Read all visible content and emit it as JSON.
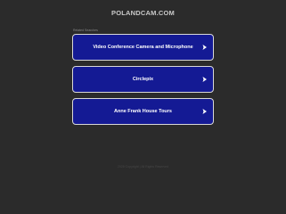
{
  "header": {
    "domain": "POLANDCAM.COM"
  },
  "related": {
    "label": "Related Searches",
    "links": [
      {
        "label": "Video Conference Camera and Microphone",
        "icon": "arrow-right-icon"
      },
      {
        "label": "Circlepix",
        "icon": "arrow-right-icon"
      },
      {
        "label": "Anne Frank House Tours",
        "icon": "arrow-right-icon"
      }
    ]
  },
  "footer": {
    "text": "2025 Copyright | All Rights Reserved"
  },
  "colors": {
    "background": "#2b2b2b",
    "link_background": "#141a94",
    "link_border": "#d8d8d8",
    "link_text": "#ffffff"
  }
}
